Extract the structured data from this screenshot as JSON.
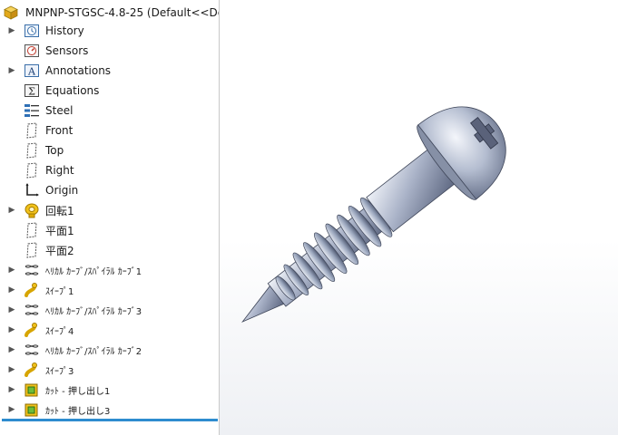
{
  "document": {
    "title": "MNPNP-STGSC-4.8-25  (Default<<Defau"
  },
  "tree": {
    "items": [
      {
        "label": "History",
        "icon": "history-icon",
        "expandable": true
      },
      {
        "label": "Sensors",
        "icon": "sensors-icon",
        "expandable": false
      },
      {
        "label": "Annotations",
        "icon": "annotations-icon",
        "expandable": true
      },
      {
        "label": "Equations",
        "icon": "equations-icon",
        "expandable": false
      },
      {
        "label": "Steel",
        "icon": "material-icon",
        "expandable": false
      },
      {
        "label": "Front",
        "icon": "plane-icon",
        "expandable": false
      },
      {
        "label": "Top",
        "icon": "plane-icon",
        "expandable": false
      },
      {
        "label": "Right",
        "icon": "plane-icon",
        "expandable": false
      },
      {
        "label": "Origin",
        "icon": "origin-icon",
        "expandable": false
      },
      {
        "label": "回転1",
        "icon": "revolve-icon",
        "expandable": true
      },
      {
        "label": "平面1",
        "icon": "plane-icon",
        "expandable": false
      },
      {
        "label": "平面2",
        "icon": "plane-icon",
        "expandable": false
      },
      {
        "label": "ﾍﾘｶﾙ ｶｰﾌﾞ/ｽﾊﾟｲﾗﾙ ｶｰﾌﾞ1",
        "icon": "helix-icon",
        "expandable": true
      },
      {
        "label": "ｽｲｰﾌﾟ1",
        "icon": "sweep-icon",
        "expandable": true
      },
      {
        "label": "ﾍﾘｶﾙ ｶｰﾌﾞ/ｽﾊﾟｲﾗﾙ ｶｰﾌﾞ3",
        "icon": "helix-icon",
        "expandable": true
      },
      {
        "label": "ｽｲｰﾌﾟ4",
        "icon": "sweep-icon",
        "expandable": true
      },
      {
        "label": "ﾍﾘｶﾙ ｶｰﾌﾞ/ｽﾊﾟｲﾗﾙ ｶｰﾌﾞ2",
        "icon": "helix-icon",
        "expandable": true
      },
      {
        "label": "ｽｲｰﾌﾟ3",
        "icon": "sweep-icon",
        "expandable": true
      },
      {
        "label": "ｶｯﾄ - 押し出し1",
        "icon": "extruded-cut-icon",
        "expandable": true
      },
      {
        "label": "ｶｯﾄ - 押し出し3",
        "icon": "extruded-cut-icon",
        "expandable": true
      }
    ]
  },
  "colors": {
    "rollback_bar": "#2e8ccf",
    "feature_yellow": "#f1c21b",
    "cut_green": "#6cbd3b",
    "screw_steel": "#9aa6bd"
  }
}
